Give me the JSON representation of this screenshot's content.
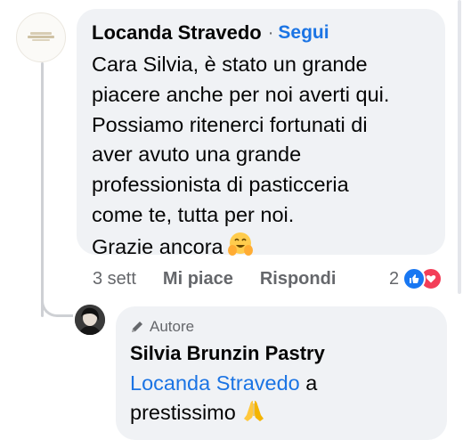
{
  "comment": {
    "author": "Locanda Stravedo",
    "separator": "·",
    "follow_label": "Segui",
    "text_lines": [
      "Cara Silvia, è stato un grande",
      "piacere anche per noi averti qui.",
      "Possiamo ritenerci fortunati di",
      "aver avuto una grande",
      "professionista di pasticceria",
      "come te, tutta per noi.",
      "Grazie ancora"
    ],
    "trailing_emoji": "smiling-face-with-open-hands-icon",
    "time": "3 sett",
    "like_label": "Mi piace",
    "reply_label": "Rispondi",
    "reaction_count": "2",
    "reaction_icons": [
      "like-reaction-icon",
      "love-reaction-icon"
    ]
  },
  "reply": {
    "badge": "Autore",
    "author": "Silvia Brunzin Pastry",
    "mention": "Locanda Stravedo",
    "text_after_mention": " a",
    "text_line2": "prestissimo",
    "trailing_emoji": "folded-hands-icon"
  },
  "colors": {
    "bubble": "#f0f2f5",
    "link": "#1b74e4",
    "secondary_text": "#65676b",
    "like_blue": "#1877f2",
    "love_red": "#f33e58"
  }
}
